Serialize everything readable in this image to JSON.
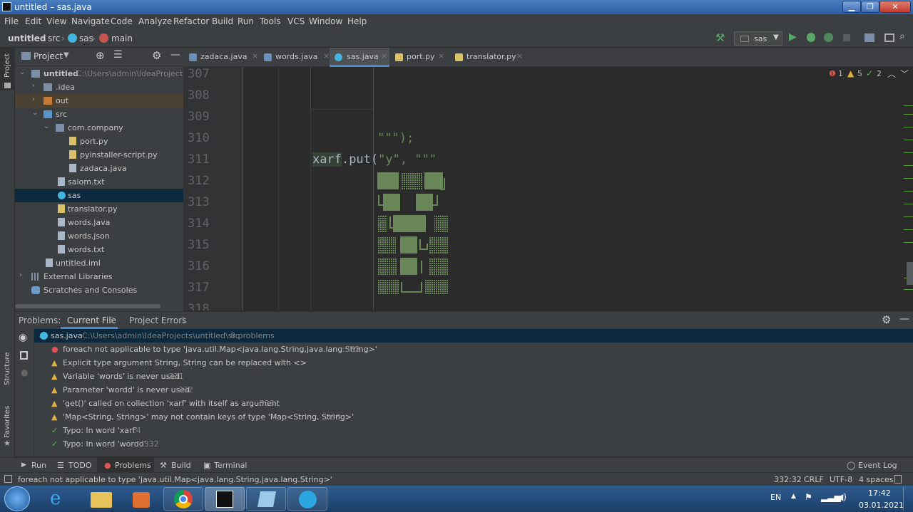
{
  "window": {
    "title": "untitled – sas.java"
  },
  "menu": [
    "File",
    "Edit",
    "View",
    "Navigate",
    "Code",
    "Analyze",
    "Refactor",
    "Build",
    "Run",
    "Tools",
    "VCS",
    "Window",
    "Help"
  ],
  "breadcrumb": {
    "project": "untitled",
    "folder": "src",
    "file": "sas",
    "method": "main"
  },
  "run_config": "sas",
  "left_strip": {
    "project": "Project",
    "structure": "Structure",
    "favorites": "Favorites"
  },
  "project_panel": {
    "title": "Project",
    "root": {
      "name": "untitled",
      "path": "C:\\Users\\admin\\IdeaProjects\\u"
    },
    "items": [
      {
        "label": ".idea"
      },
      {
        "label": "out"
      },
      {
        "label": "src"
      },
      {
        "label": "com.company"
      },
      {
        "label": "port.py"
      },
      {
        "label": "pyinstaller-script.py"
      },
      {
        "label": "zadaca.java"
      },
      {
        "label": "salom.txt"
      },
      {
        "label": "sas"
      },
      {
        "label": "translator.py"
      },
      {
        "label": "words.java"
      },
      {
        "label": "words.json"
      },
      {
        "label": "words.txt"
      },
      {
        "label": "untitled.iml"
      },
      {
        "label": "External Libraries"
      },
      {
        "label": "Scratches and Consoles"
      }
    ]
  },
  "tabs": [
    {
      "label": "zadaca.java"
    },
    {
      "label": "words.java"
    },
    {
      "label": "sas.java"
    },
    {
      "label": "port.py"
    },
    {
      "label": "translator.py"
    }
  ],
  "inspections": {
    "errors": "1",
    "warnings": "5",
    "typos": "2"
  },
  "editor": {
    "line_numbers": [
      "307",
      "308",
      "309",
      "310",
      "311",
      "312",
      "313",
      "314",
      "315",
      "316",
      "317",
      "318"
    ],
    "code_310": "\"\"\");",
    "code_311_var": "xarf",
    "code_311_call": ".put(",
    "code_311_str": "\"y\"",
    "code_311_rest": ", \"\"\""
  },
  "problems": {
    "label": "Problems:",
    "tab_current": "Current File",
    "tab_current_count": "8",
    "tab_project": "Project Errors",
    "tab_project_count": "1",
    "file": {
      "name": "sas.java",
      "path": "C:\\Users\\admin\\IdeaProjects\\untitled\\src",
      "count": "8 problems"
    },
    "items": [
      {
        "type": "error",
        "text": "foreach not applicable to type 'java.util.Map<java.lang.String,java.lang.String>'",
        "line": ":332"
      },
      {
        "type": "warning",
        "text": "Explicit type argument String, String can be replaced with <>",
        "line": ":4"
      },
      {
        "type": "warning",
        "text": "Variable 'words' is never used",
        "line": ":331"
      },
      {
        "type": "warning",
        "text": "Parameter 'wordd' is never used",
        "line": ":332"
      },
      {
        "type": "warning",
        "text": "'get()' called on collection 'xarf' with itself as argument",
        "line": ":333"
      },
      {
        "type": "warning",
        "text": "'Map<String, String>' may not contain keys of type 'Map<String, String>'",
        "line": ":333"
      },
      {
        "type": "typo",
        "text": "Typo: In word 'xarf'",
        "line": ":4"
      },
      {
        "type": "typo",
        "text": "Typo: In word 'wordd'",
        "line": ":332"
      }
    ]
  },
  "tool_windows": {
    "run": "Run",
    "todo": "TODO",
    "problems": "Problems",
    "build": "Build",
    "terminal": "Terminal",
    "event_log": "Event Log"
  },
  "status": {
    "message": "foreach not applicable to type 'java.util.Map<java.lang.String,java.lang.String>'",
    "position": "332:32",
    "line_sep": "CRLF",
    "encoding": "UTF-8",
    "indent": "4 spaces"
  },
  "taskbar": {
    "lang": "EN",
    "time": "17:42",
    "date": "03.01.2021"
  },
  "colors": {
    "error": "#e05555",
    "warning": "#e0b040",
    "typo": "#5fb25f",
    "accent": "#4a88c7",
    "string": "#6a8759",
    "keyword": "#cc7832"
  }
}
